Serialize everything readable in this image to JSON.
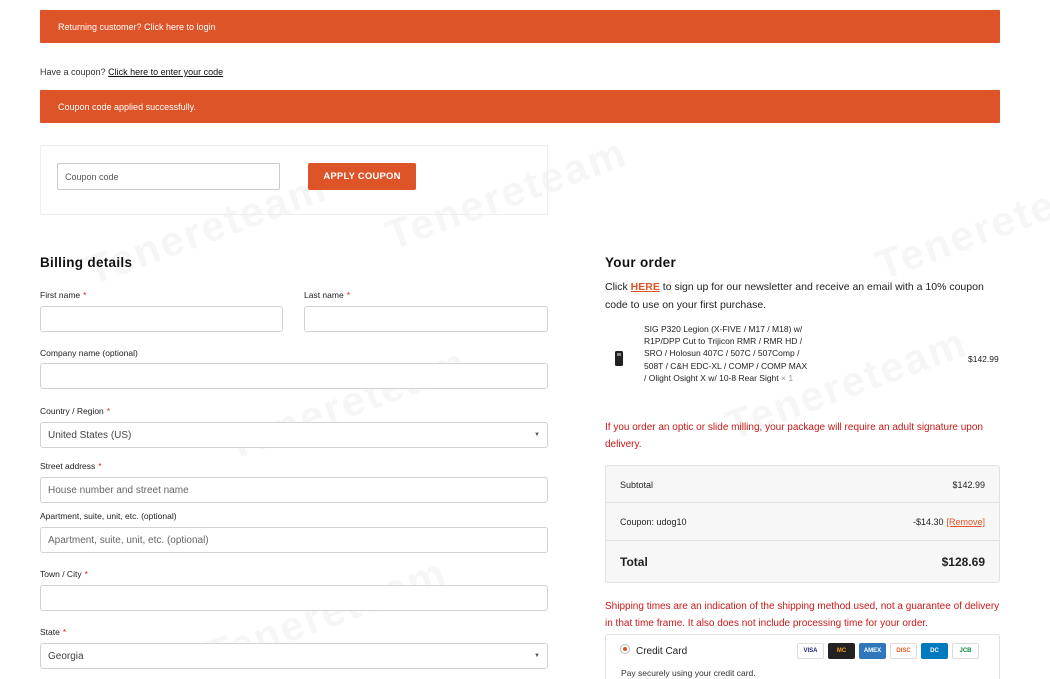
{
  "notices": {
    "login": "Returning customer? Click here to login",
    "coupon_prompt": "Have a coupon?",
    "coupon_link": "Click here to enter your code",
    "applied": "Coupon code applied successfully."
  },
  "coupon": {
    "placeholder": "Coupon code",
    "button": "APPLY COUPON"
  },
  "billing": {
    "heading": "Billing details",
    "first_name_label": "First name",
    "last_name_label": "Last name",
    "company_label": "Company name (optional)",
    "country_label": "Country / Region",
    "country_value": "United States (US)",
    "street_label": "Street address",
    "street_placeholder": "House number and street name",
    "apt_label": "Apartment, suite, unit, etc. (optional)",
    "apt_placeholder": "Apartment, suite, unit, etc. (optional)",
    "city_label": "Town / City",
    "state_label": "State",
    "state_value": "Georgia",
    "required_mark": "*"
  },
  "order": {
    "heading": "Your order",
    "newsletter_pre": "Click ",
    "newsletter_link": "HERE",
    "newsletter_post": " to sign up for our newsletter and receive an email with a 10% coupon code to use on your first purchase.",
    "product_name": "SIG P320 Legion (X-FIVE / M17 / M18) w/ R1P/DPP Cut to Trijicon RMR / RMR HD / SRO / Holosun 407C / 507C / 507Comp / 508T / C&H EDC-XL / COMP / COMP MAX / Olight Osight X w/ 10-8 Rear Sight",
    "product_qty": "× 1",
    "product_price": "$142.99",
    "optic_warning": "If you order an optic or slide milling, your package will require an adult signature upon delivery.",
    "subtotal_label": "Subtotal",
    "subtotal_value": "$142.99",
    "coupon_label": "Coupon: udog10",
    "coupon_value": "-$14.30",
    "coupon_remove": "[Remove]",
    "total_label": "Total",
    "total_value": "$128.69",
    "shipping_warning": "Shipping times are an indication of the shipping method used, not a guarantee of delivery in that time frame. It also does not include processing time for your order."
  },
  "payment": {
    "method": "Credit Card",
    "description": "Pay securely using your credit card.",
    "cards": [
      "VISA",
      "MC",
      "AMEX",
      "DISC",
      "DC",
      "JCB"
    ]
  },
  "watermark": "Tenereteam",
  "colors": {
    "accent": "#dc5427",
    "warning": "#c81818"
  }
}
